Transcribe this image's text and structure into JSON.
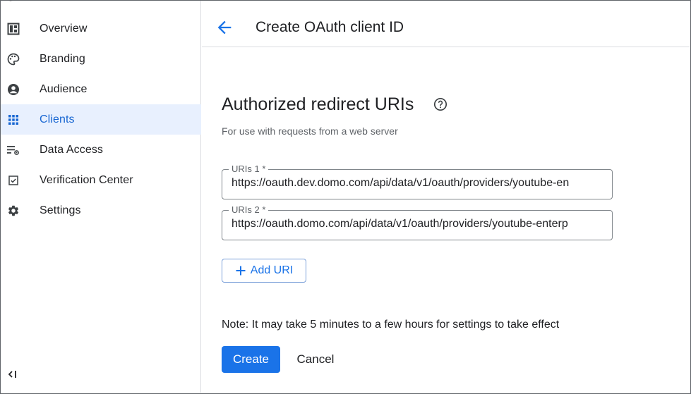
{
  "sidebar": {
    "items": [
      {
        "label": "Overview",
        "icon": "dashboard-icon"
      },
      {
        "label": "Branding",
        "icon": "palette-icon"
      },
      {
        "label": "Audience",
        "icon": "account-circle-icon"
      },
      {
        "label": "Clients",
        "icon": "apps-grid-icon",
        "active": true
      },
      {
        "label": "Data Access",
        "icon": "data-access-icon"
      },
      {
        "label": "Verification Center",
        "icon": "verified-checkbox-icon"
      },
      {
        "label": "Settings",
        "icon": "gear-icon"
      }
    ],
    "collapse_icon": "collapse-sidebar-icon"
  },
  "header": {
    "title": "Create OAuth client ID",
    "back_icon": "arrow-back-icon"
  },
  "section": {
    "title": "Authorized redirect URIs",
    "subtitle": "For use with requests from a web server",
    "help_icon": "help-circle-icon"
  },
  "uris": [
    {
      "label": "URIs 1 *",
      "value": "https://oauth.dev.domo.com/api/data/v1/oauth/providers/youtube-en"
    },
    {
      "label": "URIs 2 *",
      "value": "https://oauth.domo.com/api/data/v1/oauth/providers/youtube-enterp"
    }
  ],
  "add_uri_label": "Add URI",
  "note": "Note: It may take 5 minutes to a few hours for settings to take effect",
  "actions": {
    "create_label": "Create",
    "cancel_label": "Cancel"
  },
  "colors": {
    "accent": "#1a73e8",
    "active_bg": "#e8f0fe",
    "active_text": "#1967d2"
  }
}
